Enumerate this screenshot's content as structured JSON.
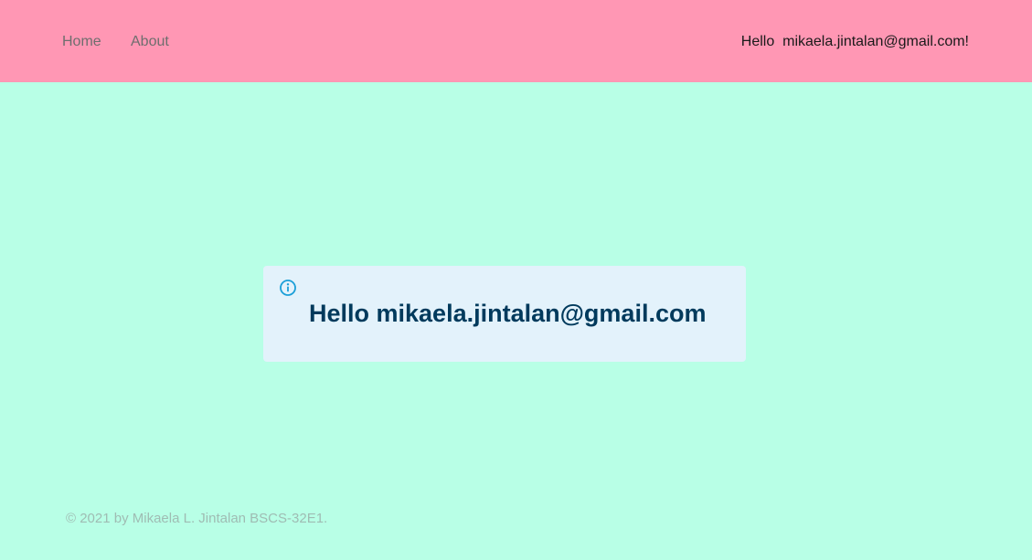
{
  "nav": {
    "items": [
      {
        "label": "Home"
      },
      {
        "label": "About"
      }
    ],
    "greeting_prefix": "Hello",
    "greeting_email": "mikaela.jintalan@gmail.com!"
  },
  "alert": {
    "icon": "info-icon",
    "message": "Hello mikaela.jintalan@gmail.com"
  },
  "footer": {
    "text": "© 2021 by Mikaela L. Jintalan BSCS-32E1."
  },
  "colors": {
    "navbar": "#ff97b4",
    "page_background": "#b8ffe6",
    "alert_background": "#e3f2fb",
    "alert_text": "#003a5c",
    "info_icon": "#1a9fd8"
  }
}
